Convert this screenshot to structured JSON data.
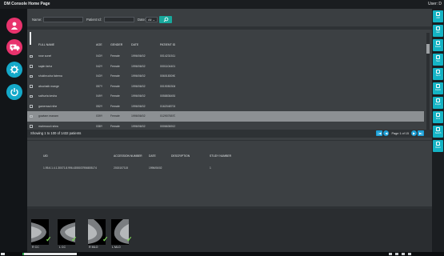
{
  "window": {
    "title": "DM Console Home Page",
    "user": "User: D"
  },
  "search": {
    "name_label": "Name:",
    "patient_id_label": "Patient Id:",
    "date_label": "Date:",
    "date_value": "All",
    "date_chevron": "⌄",
    "search_icon": "search-icon"
  },
  "table": {
    "columns": [
      "FULL NAME",
      "AGE",
      "GENDER",
      "DATE",
      "PATIENT ID"
    ],
    "rows": [
      {
        "name": "rose sonet",
        "age": "043Y",
        "gender": "Female",
        "date": "1996/06/02",
        "id": "0014231511",
        "selected": false
      },
      {
        "name": "sajah farha",
        "age": "042Y",
        "gender": "Female",
        "date": "1996/06/02",
        "id": "0001104401",
        "selected": false
      },
      {
        "name": "shukhrucha fatema",
        "age": "043Y",
        "gender": "Female",
        "date": "1996/06/02",
        "id": "0060183090",
        "selected": false
      },
      {
        "name": "abuchaib mange",
        "age": "057Y",
        "gender": "Female",
        "date": "1996/06/02",
        "id": "0019050304",
        "selected": false
      },
      {
        "name": "sathurta kesha",
        "age": "049Y",
        "gender": "Female",
        "date": "1996/06/02",
        "id": "0058836451",
        "selected": false
      },
      {
        "name": "gamemad nthe",
        "age": "052Y",
        "gender": "Female",
        "date": "1996/06/02",
        "id": "0162048701",
        "selected": false
      },
      {
        "name": "gowtam manam",
        "age": "039Y",
        "gender": "Female",
        "date": "1996/06/02",
        "id": "0129076570",
        "selected": true
      },
      {
        "name": "mahmood rahra",
        "age": "038Y",
        "gender": "Female",
        "date": "1996/06/02",
        "id": "0006636913",
        "selected": false
      },
      {
        "name": "hygium kran",
        "age": "047Y",
        "gender": "Female",
        "date": "1996/06/02",
        "id": "0080077570",
        "selected": false
      }
    ],
    "showing": "Showing 1 to 100 of 1432 patients",
    "page_label": "Page 1 of 15"
  },
  "series": {
    "columns": [
      "UID",
      "ACCESSION NUMBER",
      "DATE",
      "DESCRIPTION",
      "STUDY NUMBER"
    ],
    "rows": [
      {
        "uid": "1.95.6.1.4.1.30071.8.996.4355037956805174",
        "accession": "2015107115",
        "date": "1996/06/02",
        "description": "",
        "study": "1"
      }
    ]
  },
  "thumbnails": [
    {
      "label": "R CC"
    },
    {
      "label": "L CC"
    },
    {
      "label": "R MLO"
    },
    {
      "label": "L MLO"
    }
  ],
  "right_actions": [
    {
      "label": "Add",
      "icon": "add-icon"
    },
    {
      "label": "Edit",
      "icon": "edit-icon"
    },
    {
      "label": "Delete",
      "icon": "delete-icon"
    },
    {
      "label": "New",
      "icon": "new-icon"
    },
    {
      "label": "Send",
      "icon": "send-icon"
    },
    {
      "label": "Import",
      "icon": "import-icon"
    },
    {
      "label": "Export",
      "icon": "export-icon"
    },
    {
      "label": "Print",
      "icon": "print-icon"
    },
    {
      "label": "Search",
      "icon": "search-icon"
    },
    {
      "label": "Reset",
      "icon": "reset-icon"
    }
  ],
  "left_actions": [
    {
      "name": "patients",
      "color": "#e8336d"
    },
    {
      "name": "ambulance",
      "color": "#e8336d"
    },
    {
      "name": "settings",
      "color": "#14a9c9"
    },
    {
      "name": "power",
      "color": "#14a9c9"
    }
  ],
  "taskbar": {
    "time": "4 PM",
    "tray": "2020"
  }
}
